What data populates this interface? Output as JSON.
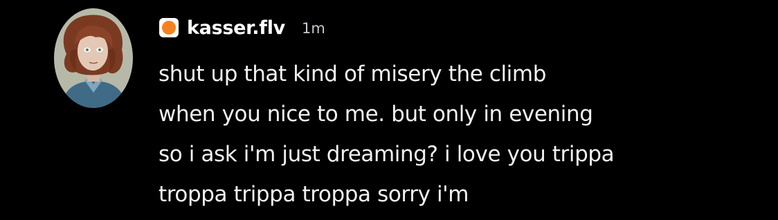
{
  "message": {
    "author": {
      "username": "kasser.flv",
      "avatar_icon": "avatar-portrait-icon",
      "role_icon": "orange-circle-icon",
      "role_color": "#f58220"
    },
    "timestamp": "1m",
    "lines": [
      "shut up that kind of misery the climb",
      "when you nice to me. but only in evening",
      "so i ask i'm just dreaming? i love you trippa",
      "troppa trippa troppa sorry i'm"
    ]
  },
  "colors": {
    "background": "#000000",
    "text": "#f2f2f2",
    "timestamp": "#c9c9cf"
  }
}
